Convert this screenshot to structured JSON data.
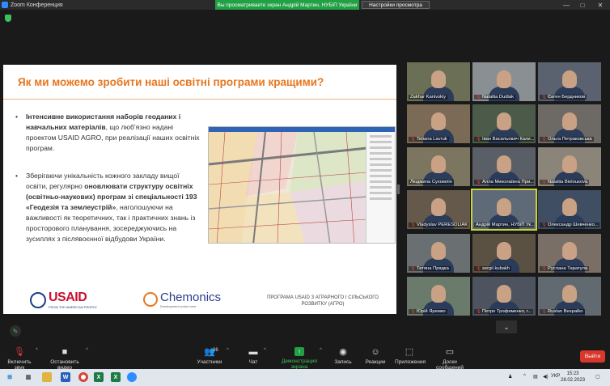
{
  "window": {
    "title": "Zoom Конференция",
    "share_banner": "Вы просматриваете экран Андрій Мартин, НУБіП України",
    "view_options": "Настройки просмотра",
    "controls": [
      "—",
      "□",
      "✕"
    ]
  },
  "slide": {
    "title": "Як ми можемо зробити наші освітні програми кращими?",
    "bullet1": {
      "bold": "Інтенсивне використання наборів геоданих і навчальних матеріалів",
      "rest": ", що люб'язно надані проектом USAID AGRO, при реалізації наших освітніх програм."
    },
    "bullet2": {
      "lead": "Зберігаючи унікальність кожного закладу вищої освіти, регулярно ",
      "bold": "оновлювати структуру освітніх (освітньо-наукових) програм зі спеціальності 193 «Геодезія та землеустрій»",
      "rest": ", наголошуючи на важливості як теоретичних, так і практичних знань із просторового планування, зосереджуючись на зусиллях з післявоєнної відбудови України."
    },
    "usaid_logo": "USAID",
    "usaid_tagline": "FROM THE AMERICAN PEOPLE",
    "chemonics_logo": "Chemonics",
    "chemonics_tagline": "Development works here.",
    "program": "ПРОГРАМА USAID З АГРАРНОГО І СІЛЬСЬКОГО РОЗВИТКУ (АГРО)"
  },
  "participants": [
    {
      "name": "Zakhar Kanivskiy",
      "muted": false
    },
    {
      "name": "Nataliia Dudiak",
      "muted": true
    },
    {
      "name": "Євген Бердников",
      "muted": true
    },
    {
      "name": "Tetiana Lavruk",
      "muted": true
    },
    {
      "name": "Іван Васильович Кали...",
      "muted": true
    },
    {
      "name": "Ольга Петраковська",
      "muted": true
    },
    {
      "name": "Людмила Сухомлін",
      "muted": false
    },
    {
      "name": "Алла Миколаївна При...",
      "muted": true
    },
    {
      "name": "Nataliia Bielousova",
      "muted": true
    },
    {
      "name": "Vladyslav PERESOLIAK",
      "muted": true
    },
    {
      "name": "Андрій Мартин, НУБіП Ук...",
      "muted": false
    },
    {
      "name": "Олександр Шевченко...",
      "muted": true
    },
    {
      "name": "Тетяна Прядка",
      "muted": true
    },
    {
      "name": "sergii kubakh",
      "muted": true
    },
    {
      "name": "Руслана Таратула",
      "muted": true
    },
    {
      "name": "Юрій Яремко",
      "muted": true
    },
    {
      "name": "Петро Трофименко, г...",
      "muted": true
    },
    {
      "name": "Ruslan Bespalko",
      "muted": true
    }
  ],
  "toolbar": {
    "audio": "Включить звук",
    "video": "Остановить видео",
    "participants": "Участники",
    "participants_count": "36",
    "chat": "Чат",
    "share": "Демонстрация экрана",
    "record": "Запись",
    "reactions": "Реакции",
    "apps": "Приложения",
    "whiteboards": "Доски сообщений",
    "leave": "Выйти"
  },
  "taskbar": {
    "language": "УКР",
    "time": "15:23",
    "date": "28.02.2023"
  }
}
